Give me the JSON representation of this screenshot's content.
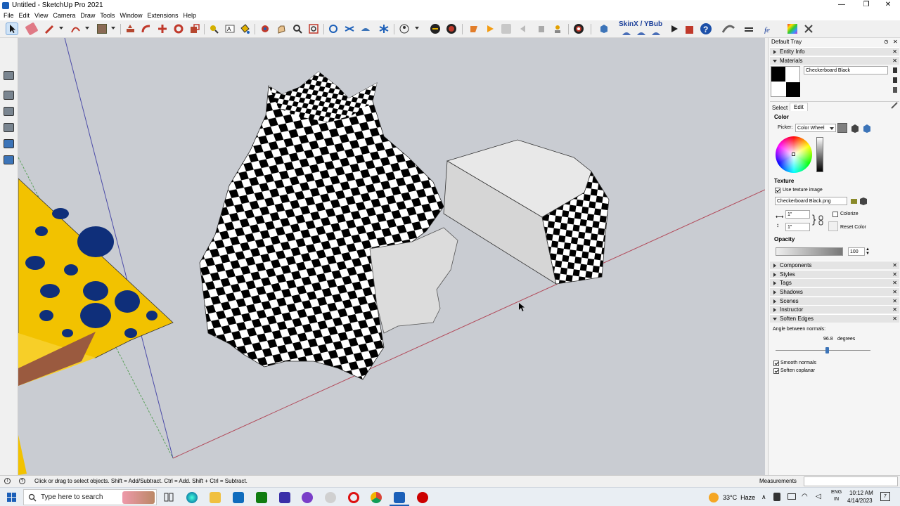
{
  "window": {
    "title": "Untitled - SketchUp Pro 2021",
    "controls": {
      "minimize": "—",
      "maximize": "❐",
      "close": "✕"
    }
  },
  "menu": [
    "File",
    "Edit",
    "View",
    "Camera",
    "Draw",
    "Tools",
    "Window",
    "Extensions",
    "Help"
  ],
  "toolbar": {
    "skin_label": "SkinX / YBub"
  },
  "tray": {
    "title": "Default Tray",
    "sections": {
      "entity_info": "Entity Info",
      "materials": "Materials"
    },
    "material_name": "Checkerboard Black",
    "tabs": {
      "select": "Select",
      "edit": "Edit"
    },
    "color": {
      "heading": "Color",
      "picker_label": "Picker:",
      "picker_value": "Color Wheel"
    },
    "texture": {
      "heading": "Texture",
      "use_image_label": "Use texture image",
      "filename": "Checkerboard Black.png",
      "width": "1\"",
      "height": "1\"",
      "colorize_label": "Colorize",
      "reset_label": "Reset Color"
    },
    "opacity": {
      "heading": "Opacity",
      "value": "100",
      "level": 1.0
    },
    "collapsed": [
      "Components",
      "Styles",
      "Tags",
      "Shadows",
      "Scenes",
      "Instructor"
    ],
    "soften": {
      "title": "Soften Edges",
      "angle_label": "Angle between normals:",
      "angle_value": "96.8",
      "angle_unit": "degrees",
      "smooth_label": "Smooth normals",
      "coplanar_label": "Soften coplanar"
    }
  },
  "status": {
    "hint": "Click or drag to select objects. Shift = Add/Subtract. Ctrl = Add. Shift + Ctrl = Subtract.",
    "measurements_label": "Measurements"
  },
  "taskbar": {
    "search_placeholder": "Type here to search",
    "weather": "33°C  Haze",
    "lang_top": "ENG",
    "lang_bottom": "IN",
    "time": "10:12 AM",
    "date": "4/14/2023",
    "notifications": "7"
  },
  "colors": {
    "accent": "#1b5fb8",
    "viewport_bg": "#c9ccd2",
    "yellow": "#f5c400",
    "blue_spot": "#0f2f7a",
    "brown": "#9a5a3f"
  }
}
